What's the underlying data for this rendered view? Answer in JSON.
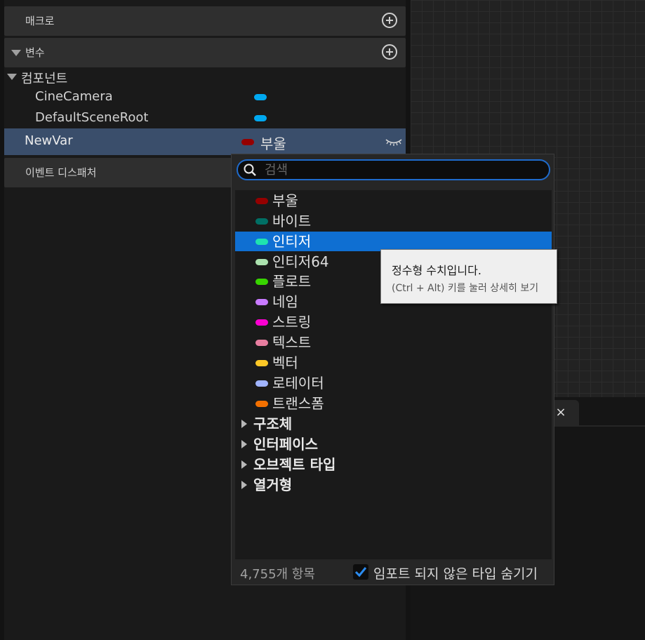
{
  "panel": {
    "macros_label": "매크로",
    "variables_label": "변수",
    "components_label": "컴포넌트",
    "components": [
      {
        "name": "CineCamera",
        "color": "#00a8f0"
      },
      {
        "name": "DefaultSceneRoot",
        "color": "#00a8f0"
      }
    ],
    "selected_variable": {
      "name": "NewVar",
      "type": "부울",
      "type_color": "#950000"
    },
    "event_dispatchers_label": "이벤트 디스패처"
  },
  "type_picker": {
    "search_placeholder": "검색",
    "types": [
      {
        "label": "부울",
        "color": "#950000",
        "selected": false
      },
      {
        "label": "바이트",
        "color": "#006f65",
        "selected": false
      },
      {
        "label": "인티저",
        "color": "#1fe3af",
        "selected": true
      },
      {
        "label": "인티저64",
        "color": "#ace3af",
        "selected": false
      },
      {
        "label": "플로트",
        "color": "#38d500",
        "selected": false
      },
      {
        "label": "네임",
        "color": "#c87aff",
        "selected": false
      },
      {
        "label": "스트링",
        "color": "#fa00d1",
        "selected": false
      },
      {
        "label": "텍스트",
        "color": "#e87ea0",
        "selected": false
      },
      {
        "label": "벡터",
        "color": "#fdc827",
        "selected": false
      },
      {
        "label": "로테이터",
        "color": "#a0b4ff",
        "selected": false
      },
      {
        "label": "트랜스폼",
        "color": "#f37000",
        "selected": false
      }
    ],
    "categories": [
      "구조체",
      "인터페이스",
      "오브젝트 타입",
      "열거형"
    ],
    "count_text": "4,755개 항목",
    "hide_unimported_label": "임포트 되지 않은 타입 숨기기",
    "hide_unimported_checked": true
  },
  "tooltip": {
    "line1": "정수형 수치입니다.",
    "line2": "(Ctrl + Alt) 키를 눌러 상세히 보기"
  },
  "graph_tab": {
    "close_symbol": "×"
  }
}
